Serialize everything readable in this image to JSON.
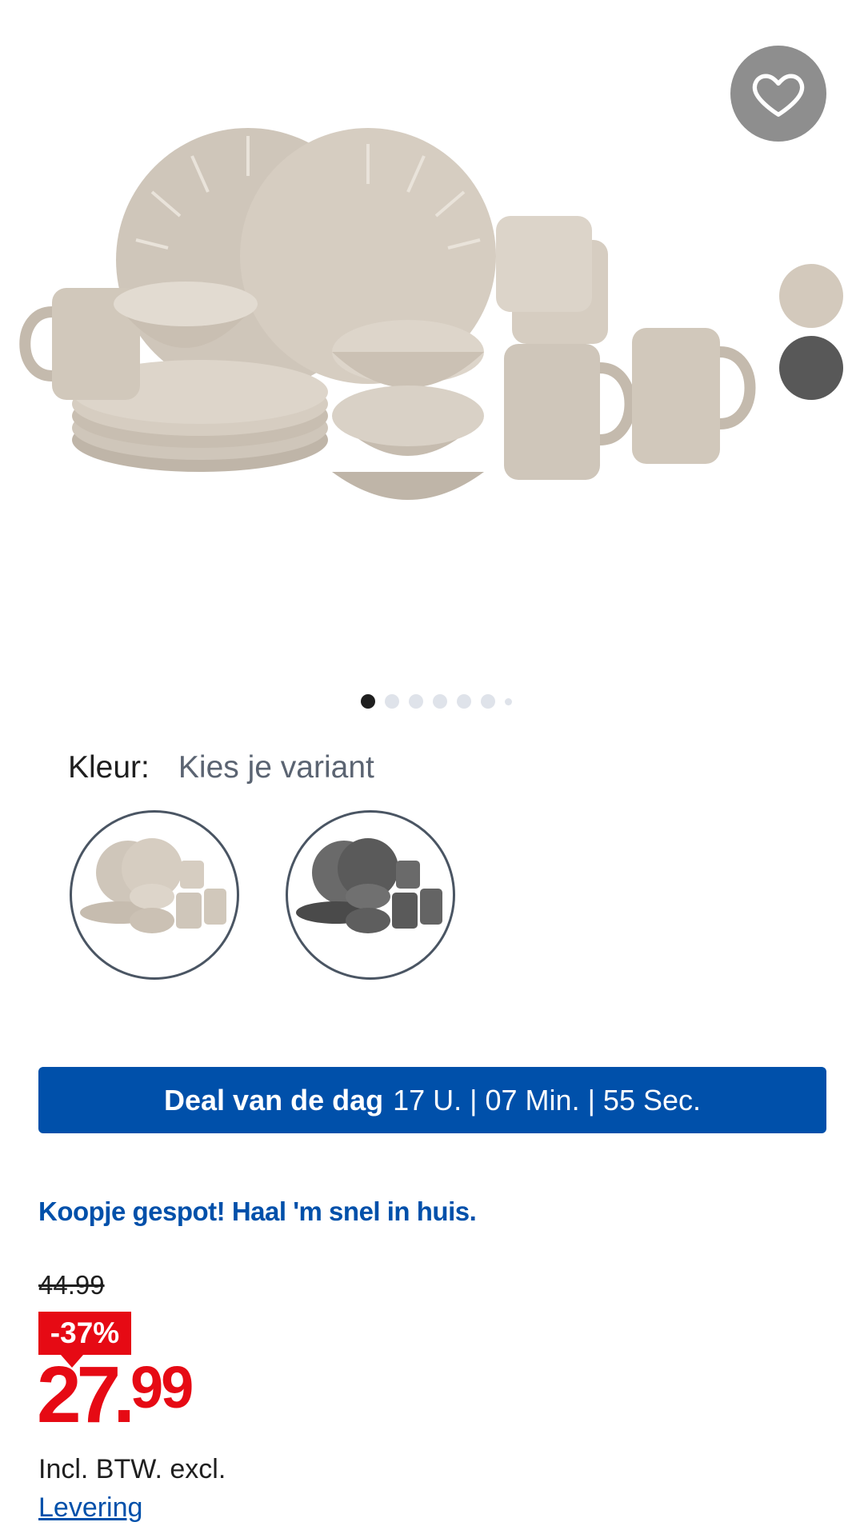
{
  "product": {
    "image_alt": "Servies set beige",
    "favorite_icon": "heart-icon",
    "color_swatches": [
      {
        "name": "beige",
        "color": "#d3c9bc"
      },
      {
        "name": "grey",
        "color": "#585858"
      }
    ],
    "gallery_pages": 7,
    "gallery_active_index": 0
  },
  "variant": {
    "label": "Kleur:",
    "placeholder": "Kies je variant",
    "options": [
      "beige",
      "grey"
    ]
  },
  "deal": {
    "title": "Deal van de dag",
    "countdown": "17 U. | 07 Min. | 55 Sec."
  },
  "promo": {
    "text": "Koopje gespot! Haal 'm snel in huis."
  },
  "price": {
    "old": "44.99",
    "discount": "-37%",
    "euros": "27",
    "cents": "99",
    "vat": "Incl. BTW. excl.",
    "delivery_link": "Levering"
  },
  "colors": {
    "brand_blue": "#0050aa",
    "price_red": "#e60a14"
  }
}
